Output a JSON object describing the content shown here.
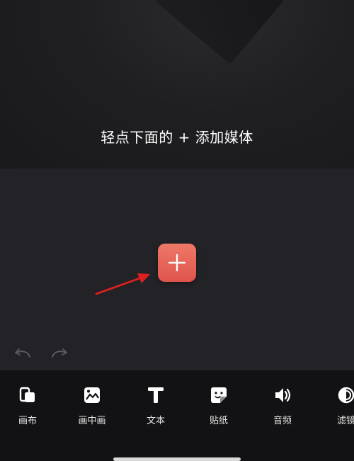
{
  "preview": {
    "hint": "轻点下面的 + 添加媒体"
  },
  "colors": {
    "accent": "#e8625a",
    "arrow": "#e02020",
    "toolbar_bg": "#121214",
    "timeline_bg": "#232327"
  },
  "toolbar": {
    "items": [
      {
        "label": "画布",
        "icon": "canvas-icon"
      },
      {
        "label": "画中画",
        "icon": "picture-in-picture-icon"
      },
      {
        "label": "文本",
        "icon": "text-icon"
      },
      {
        "label": "贴纸",
        "icon": "sticker-icon"
      },
      {
        "label": "音频",
        "icon": "audio-icon"
      },
      {
        "label": "滤镜",
        "icon": "filter-icon"
      }
    ]
  },
  "icons": {
    "undo": "undo-icon",
    "redo": "redo-icon",
    "add": "plus-icon"
  }
}
